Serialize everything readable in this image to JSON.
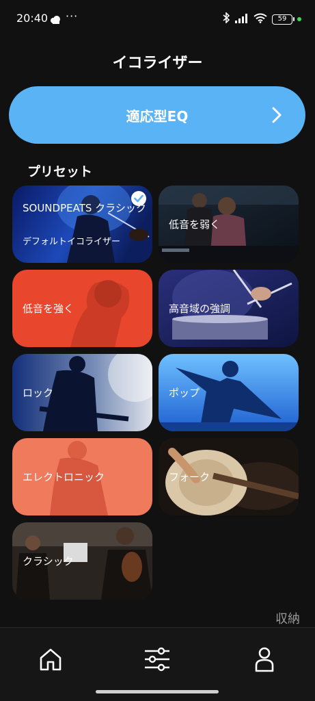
{
  "status_bar": {
    "time": "20:40",
    "dots": "···",
    "battery": "59"
  },
  "header": {
    "title": "イコライザー"
  },
  "adaptive_eq": {
    "label": "適応型EQ"
  },
  "presets": {
    "title": "プリセット",
    "items": [
      {
        "label": "SOUNDPEATS クラシック",
        "sublabel": "デフォルトイコライザー",
        "selected": true
      },
      {
        "label": "低音を弱く"
      },
      {
        "label": "低音を強く"
      },
      {
        "label": "高音域の強調"
      },
      {
        "label": "ロック"
      },
      {
        "label": "ポップ"
      },
      {
        "label": "エレクトロニック"
      },
      {
        "label": "フォーク"
      },
      {
        "label": "クラシック"
      }
    ]
  },
  "collapse_label": "収納",
  "colors": {
    "accent": "#5ab3f5",
    "background": "#111111",
    "orange": "#e8472e",
    "coral": "#f07a5c"
  },
  "icons": [
    "home-icon",
    "equalizer-icon",
    "profile-icon",
    "chevron-right-icon",
    "check-icon",
    "bluetooth-icon",
    "signal-icon",
    "wifi-icon",
    "battery-icon",
    "cloud-icon"
  ]
}
